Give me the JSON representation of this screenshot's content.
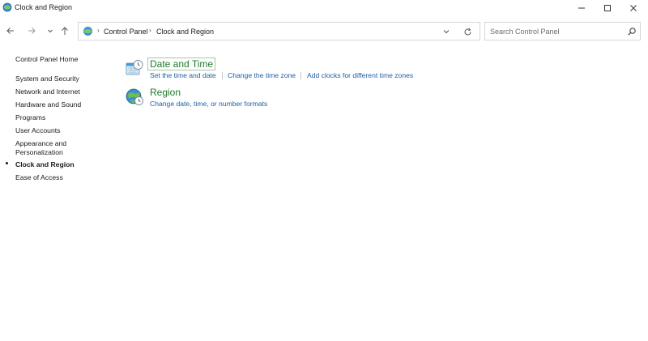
{
  "window": {
    "title": "Clock and Region"
  },
  "address_bar": {
    "breadcrumbs": [
      "Control Panel",
      "Clock and Region"
    ]
  },
  "search": {
    "placeholder": "Search Control Panel"
  },
  "sidebar": {
    "items": [
      {
        "label": "Control Panel Home"
      },
      {
        "label": "System and Security"
      },
      {
        "label": "Network and Internet"
      },
      {
        "label": "Hardware and Sound"
      },
      {
        "label": "Programs"
      },
      {
        "label": "User Accounts"
      },
      {
        "label": "Appearance and"
      },
      {
        "label": "Personalization"
      },
      {
        "label": "Clock and Region"
      },
      {
        "label": "Ease of Access"
      }
    ],
    "current_index": 8
  },
  "categories": [
    {
      "title": "Date and Time",
      "icon": "clock-calendar-icon",
      "links": [
        "Set the time and date",
        "Change the time zone",
        "Add clocks for different time zones"
      ]
    },
    {
      "title": "Region",
      "icon": "globe-clock-icon",
      "links": [
        "Change date, time, or number formats"
      ]
    }
  ],
  "colors": {
    "category_title": "#1e7b2a",
    "link": "#1a5fa6"
  }
}
